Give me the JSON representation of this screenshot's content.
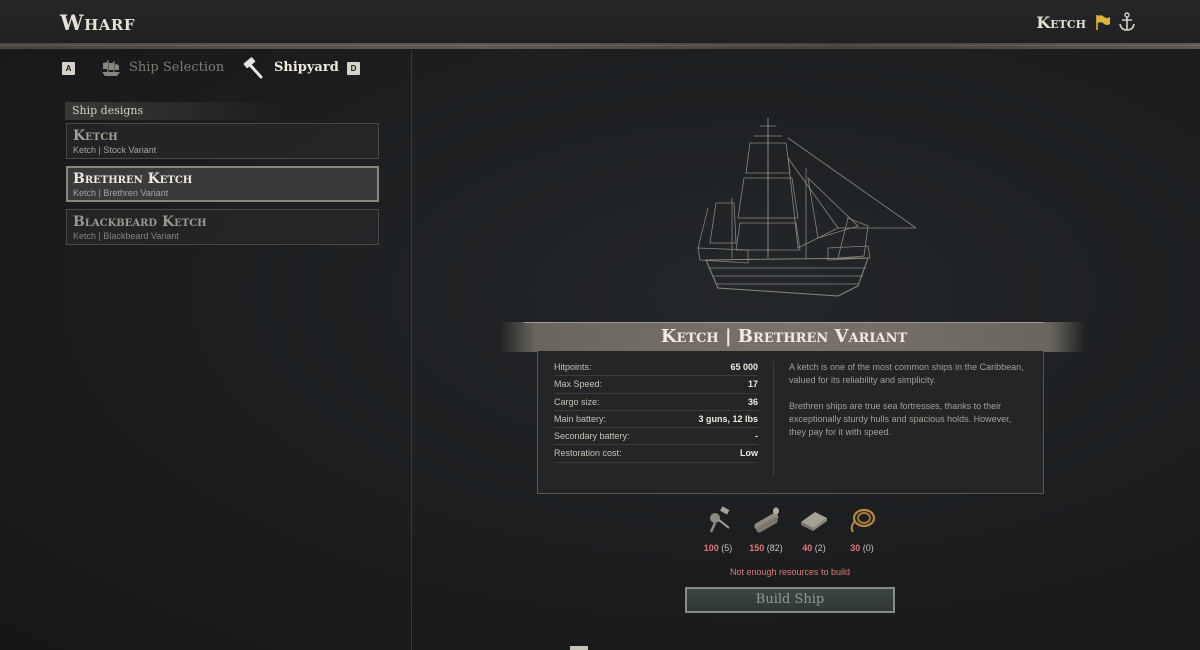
{
  "header": {
    "title": "Wharf",
    "current_ship": "Ketch",
    "icons": [
      "flag-icon",
      "anchor-icon"
    ]
  },
  "tabs": {
    "prev_key": "A",
    "ship_selection": "Ship Selection",
    "shipyard": "Shipyard",
    "next_key": "D"
  },
  "designs": {
    "section_label": "Ship designs",
    "items": [
      {
        "name": "Ketch",
        "sub": "Ketch | Stock Variant"
      },
      {
        "name": "Brethren Ketch",
        "sub": "Ketch | Brethren Variant"
      },
      {
        "name": "Blackbeard Ketch",
        "sub": "Ketch | Blackbeard Variant"
      }
    ],
    "selected_index": 1
  },
  "info": {
    "title": "Ketch | Brethren Variant",
    "stats": [
      {
        "label": "Hitpoints:",
        "value": "65 000"
      },
      {
        "label": "Max Speed:",
        "value": "17"
      },
      {
        "label": "Cargo size:",
        "value": "36"
      },
      {
        "label": "Main battery:",
        "value": "3 guns, 12 lbs"
      },
      {
        "label": "Secondary battery:",
        "value": "-"
      },
      {
        "label": "Restoration cost:",
        "value": "Low"
      }
    ],
    "description": [
      "A ketch is one of the most common ships in the Caribbean, valued for its reliability and simplicity.",
      "Brethren ships are true sea fortresses, thanks to their exceptionally sturdy hulls and spacious holds. However, they pay for it with speed."
    ]
  },
  "resources": [
    {
      "icon": "hardware-icon",
      "need": "100",
      "have": "(5)"
    },
    {
      "icon": "timber-icon",
      "need": "150",
      "have": "(82)"
    },
    {
      "icon": "cloth-icon",
      "need": "40",
      "have": "(2)"
    },
    {
      "icon": "rope-icon",
      "need": "30",
      "have": "(0)"
    }
  ],
  "warning": "Not enough resources to build",
  "build_button": "Build Ship",
  "colors": {
    "background": "#1c1e20",
    "text_primary": "#e6e0d2",
    "warning_red": "#e07a78",
    "flag_yellow": "#e0b43a"
  }
}
